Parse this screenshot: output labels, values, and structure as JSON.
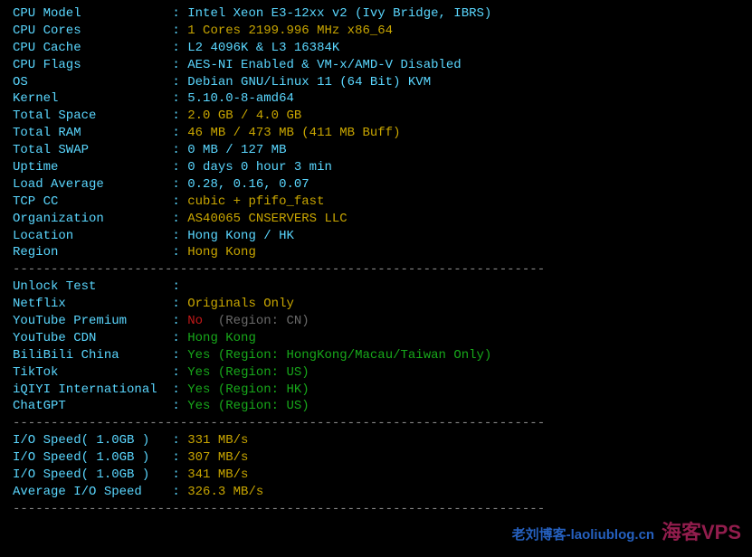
{
  "sys": {
    "cpu_model": {
      "l": "CPU Model",
      "v": "Intel Xeon E3-12xx v2 (Ivy Bridge, IBRS)",
      "c": "cyan"
    },
    "cpu_cores": {
      "l": "CPU Cores",
      "v": "1 Cores 2199.996 MHz x86_64",
      "c": "yel"
    },
    "cpu_cache": {
      "l": "CPU Cache",
      "v": "L2 4096K & L3 16384K",
      "c": "cyan"
    },
    "cpu_flags": {
      "l": "CPU Flags",
      "v": "AES-NI Enabled & VM-x/AMD-V Disabled",
      "c": "cyan"
    },
    "os": {
      "l": "OS",
      "v": "Debian GNU/Linux 11 (64 Bit) KVM",
      "c": "cyan"
    },
    "kernel": {
      "l": "Kernel",
      "v": "5.10.0-8-amd64",
      "c": "cyan"
    },
    "space": {
      "l": "Total Space",
      "v": "2.0 GB / 4.0 GB",
      "c": "yel"
    },
    "ram": {
      "l": "Total RAM",
      "v": "46 MB / 473 MB (411 MB Buff)",
      "c": "yel"
    },
    "swap": {
      "l": "Total SWAP",
      "v": "0 MB / 127 MB",
      "c": "cyan"
    },
    "uptime": {
      "l": "Uptime",
      "v": "0 days 0 hour 3 min",
      "c": "cyan"
    },
    "load": {
      "l": "Load Average",
      "v": "0.28, 0.16, 0.07",
      "c": "cyan"
    },
    "tcpcc": {
      "l": "TCP CC",
      "v": "cubic + pfifo_fast",
      "c": "yel"
    },
    "org": {
      "l": "Organization",
      "v": "AS40065 CNSERVERS LLC",
      "c": "yel"
    },
    "loc": {
      "l": "Location",
      "v": "Hong Kong / HK",
      "c": "cyan"
    },
    "region": {
      "l": "Region",
      "v": "Hong Kong",
      "c": "yel"
    }
  },
  "unlock_header": "Unlock Test",
  "unlock": [
    {
      "l": "Netflix",
      "v": "Originals Only",
      "c": "yel",
      "note": "",
      "nc": ""
    },
    {
      "l": "YouTube Premium",
      "v": "No",
      "c": "red",
      "note": "  (Region: CN)",
      "nc": "gry"
    },
    {
      "l": "YouTube CDN",
      "v": "Hong Kong",
      "c": "grn",
      "note": "",
      "nc": ""
    },
    {
      "l": "BiliBili China",
      "v": "Yes",
      "c": "grn",
      "note": " (Region: HongKong/Macau/Taiwan Only)",
      "nc": "grn"
    },
    {
      "l": "TikTok",
      "v": "Yes",
      "c": "grn",
      "note": " (Region: US)",
      "nc": "grn"
    },
    {
      "l": "iQIYI International",
      "v": "Yes",
      "c": "grn",
      "note": " (Region: HK)",
      "nc": "grn"
    },
    {
      "l": "ChatGPT",
      "v": "Yes",
      "c": "grn",
      "note": " (Region: US)",
      "nc": "grn"
    }
  ],
  "io": [
    {
      "l": "I/O Speed( 1.0GB )",
      "v": "331 MB/s"
    },
    {
      "l": "I/O Speed( 1.0GB )",
      "v": "307 MB/s"
    },
    {
      "l": "I/O Speed( 1.0GB )",
      "v": "341 MB/s"
    },
    {
      "l": "Average I/O Speed",
      "v": "326.3 MB/s"
    }
  ],
  "watermark": {
    "a": "老刘博客-laoliublog.cn",
    "b": "海客VPS"
  }
}
